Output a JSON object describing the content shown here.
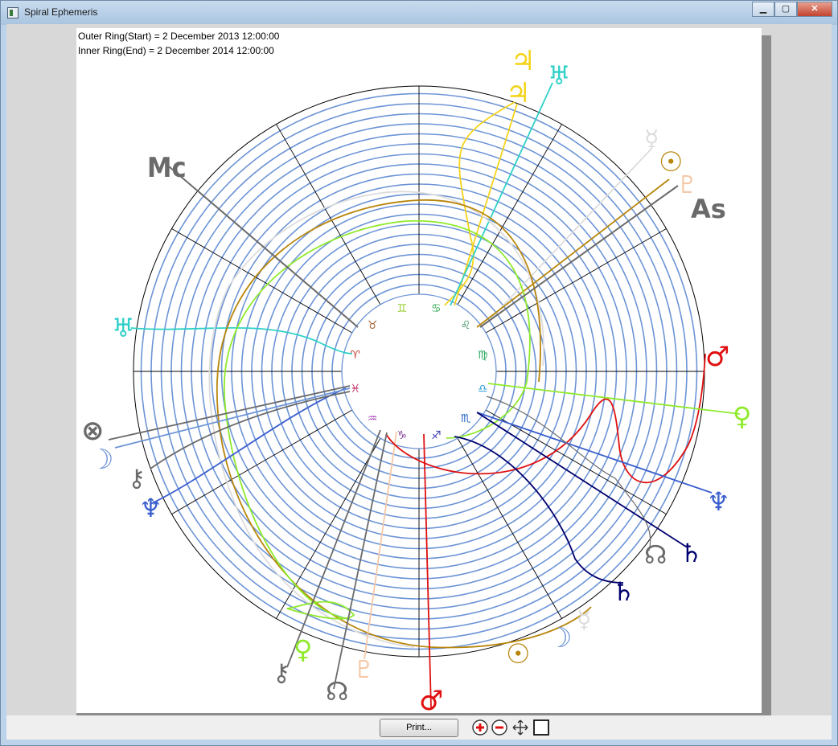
{
  "window": {
    "title": "Spiral Ephemeris",
    "controls": {
      "minimize": "▁",
      "maximize": "▢",
      "close": "✕"
    }
  },
  "info": {
    "outer_ring": "Outer Ring(Start) = 2 December 2013 12:00:00",
    "inner_ring": "Inner Ring(End) = 2 December 2014 12:00:00"
  },
  "zodiac": [
    "♈",
    "♉",
    "♊",
    "♋",
    "♌",
    "♍",
    "♎",
    "♏",
    "♐",
    "♑",
    "♒",
    "♓"
  ],
  "angles": {
    "mc": "Mc",
    "asc": "As"
  },
  "bodies": {
    "jupiter": "♃",
    "uranus": "♅",
    "mercury": "☿",
    "sun": "☉",
    "pluto": "♇",
    "mars": "♂",
    "venus": "♀",
    "neptune": "♆",
    "saturn": "♄",
    "node": "☊",
    "moon": "☽",
    "chiron": "⚷",
    "fortune": "⊗"
  },
  "colors": {
    "ring": "#6c94d6",
    "jupiter": "#f5d31a",
    "uranus": "#2fd0c8",
    "mercury": "#d9d9d9",
    "sun": "#b8860b",
    "pluto": "#f5c8a8",
    "mars": "#e01010",
    "venus": "#8fea2a",
    "neptune": "#3a5fcd",
    "saturn": "#00006e",
    "node": "#6a6a6a",
    "moon": "#6c94d6"
  },
  "toolbar": {
    "print_label": "Print..."
  }
}
